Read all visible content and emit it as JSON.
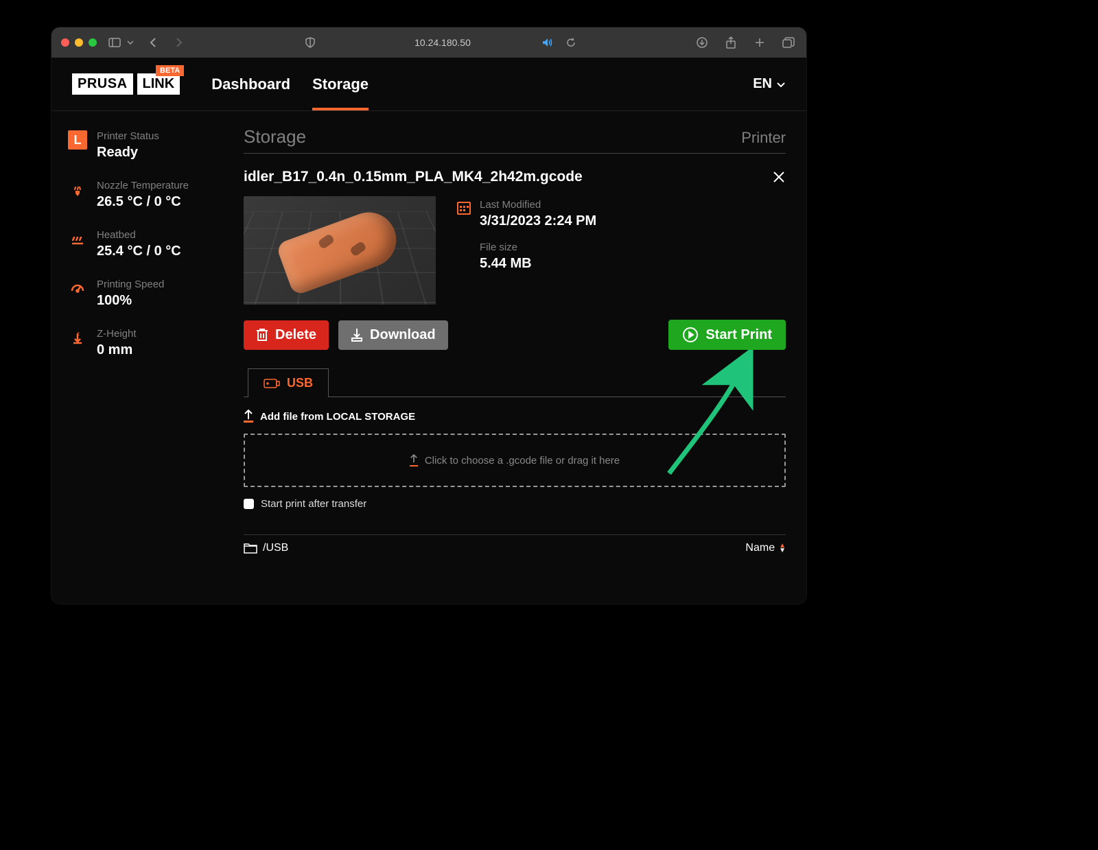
{
  "browser": {
    "address": "10.24.180.50"
  },
  "header": {
    "logo_a": "PRUSA",
    "logo_b": "LINK",
    "beta": "BETA",
    "tabs": {
      "dashboard": "Dashboard",
      "storage": "Storage"
    },
    "lang": "EN"
  },
  "sidebar": {
    "status": {
      "label": "Printer Status",
      "value": "Ready",
      "icon_letter": "L"
    },
    "nozzle": {
      "label": "Nozzle Temperature",
      "value": "26.5 °C / 0 °C"
    },
    "heatbed": {
      "label": "Heatbed",
      "value": "25.4 °C / 0 °C"
    },
    "speed": {
      "label": "Printing Speed",
      "value": "100%"
    },
    "zheight": {
      "label": "Z-Height",
      "value": "0 mm"
    }
  },
  "page": {
    "title": "Storage",
    "subtitle": "Printer"
  },
  "file": {
    "name": "idler_B17_0.4n_0.15mm_PLA_MK4_2h42m.gcode",
    "modified_label": "Last Modified",
    "modified_value": "3/31/2023 2:24 PM",
    "size_label": "File size",
    "size_value": "5.44 MB"
  },
  "actions": {
    "delete": "Delete",
    "download": "Download",
    "start": "Start Print"
  },
  "storage": {
    "tab": "USB",
    "add_file": "Add file from LOCAL STORAGE",
    "dropzone": "Click to choose a .gcode file or drag it here",
    "checkbox": "Start print after transfer",
    "path": "/USB",
    "sort_col": "Name"
  }
}
